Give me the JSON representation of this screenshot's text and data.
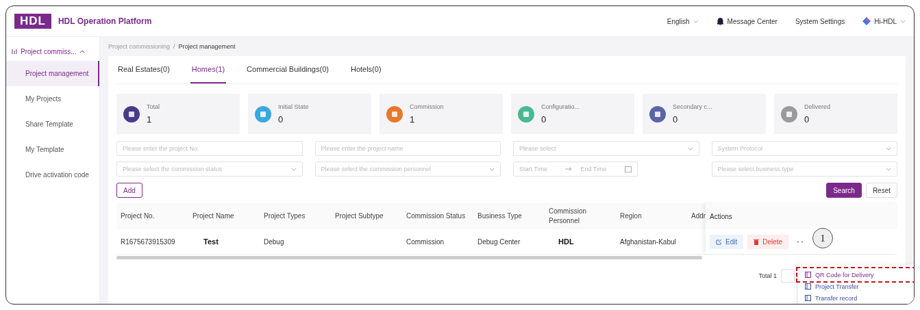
{
  "header": {
    "logo": "HDL",
    "title": "HDL Operation Platform",
    "language": "English",
    "message_center": "Message Center",
    "system_settings": "System Settings",
    "user": "Hi-HDL"
  },
  "sidebar": {
    "group": {
      "label": "Project commiss...",
      "expanded": true
    },
    "items": [
      {
        "label": "Project management",
        "selected": true
      },
      {
        "label": "My Projects",
        "selected": false
      },
      {
        "label": "Share Template",
        "selected": false
      },
      {
        "label": "My Template",
        "selected": false
      },
      {
        "label": "Drive activation code",
        "selected": false
      }
    ]
  },
  "breadcrumb": {
    "items": [
      "Project commissioning",
      "Project management"
    ],
    "separator": "/"
  },
  "tabs": [
    {
      "label": "Real Estates(0)",
      "selected": false
    },
    {
      "label": "Homes(1)",
      "selected": true
    },
    {
      "label": "Commercial Buildings(0)",
      "selected": false
    },
    {
      "label": "Hotels(0)",
      "selected": false
    }
  ],
  "stats": [
    {
      "label": "Total",
      "value": "1",
      "color": "#4a3a8c"
    },
    {
      "label": "Initial State",
      "value": "0",
      "color": "#3aa8e0"
    },
    {
      "label": "Commission",
      "value": "1",
      "color": "#e8782a"
    },
    {
      "label": "Configuratio...",
      "value": "0",
      "color": "#4cb890"
    },
    {
      "label": "Secondary c...",
      "value": "0",
      "color": "#5a64a8"
    },
    {
      "label": "Delivered",
      "value": "0",
      "color": "#9a9a9a"
    }
  ],
  "filters": [
    {
      "kind": "input",
      "placeholder": "Please enter the project No."
    },
    {
      "kind": "input",
      "placeholder": "Please enter the project name"
    },
    {
      "kind": "select",
      "placeholder": "Please select"
    },
    {
      "kind": "select",
      "placeholder": "System Protocol"
    },
    {
      "kind": "select",
      "placeholder": "Please select the commission status"
    },
    {
      "kind": "select",
      "placeholder": "Please select the commission personnel"
    },
    {
      "kind": "daterange",
      "placeholder": "Start Time",
      "placeholder_end": "End Time"
    },
    {
      "kind": "select",
      "placeholder": "Please select business type"
    }
  ],
  "add_button": "Add",
  "search_button": "Search",
  "reset_button": "Reset",
  "table": {
    "columns": [
      "Project No.",
      "Project Name",
      "Project Types",
      "Project Subtype",
      "Commission Status",
      "Business Type",
      "Commission Personnel",
      "Region",
      "Addr",
      "Actions"
    ],
    "rows": [
      {
        "cells": [
          "R1675673915309",
          "Test",
          "Debug",
          "",
          "Commission",
          "Debug Center",
          "HDL",
          "Afghanistan-Kabul"
        ],
        "edit": "Edit",
        "delete": "Delete"
      }
    ]
  },
  "pagination": {
    "total": "Total 1"
  },
  "annotation": "1",
  "action_menu": [
    {
      "label": "QR Code for Delivery",
      "highlighted": true
    },
    {
      "label": "Project Transfer",
      "highlighted": false
    },
    {
      "label": "Transfer record",
      "highlighted": false
    }
  ]
}
